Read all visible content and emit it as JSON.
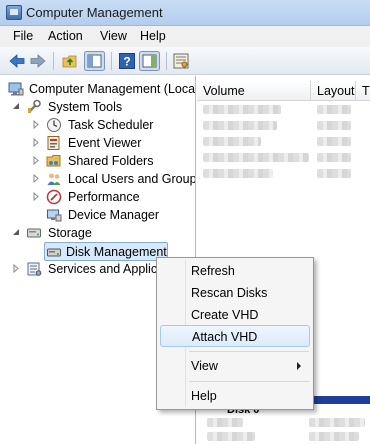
{
  "window": {
    "title": "Computer Management"
  },
  "menu": [
    "File",
    "Action",
    "View",
    "Help"
  ],
  "toolbar": {
    "buttons": [
      "back-arrow-icon",
      "forward-arrow-icon",
      "up-folder-icon",
      "show-hide-tree-icon",
      "help-icon",
      "show-action-pane-icon",
      "properties-icon"
    ]
  },
  "tree": {
    "root": "Computer Management (Local",
    "system_tools": "System Tools",
    "task_scheduler": "Task Scheduler",
    "event_viewer": "Event Viewer",
    "shared_folders": "Shared Folders",
    "local_users": "Local Users and Groups",
    "performance": "Performance",
    "device_manager": "Device Manager",
    "storage": "Storage",
    "disk_management": "Disk Management",
    "services": "Services and Applica"
  },
  "list": {
    "columns": [
      "Volume",
      "Layout",
      "T"
    ]
  },
  "disk": {
    "label": "Disk 0"
  },
  "context_menu": {
    "items": [
      "Refresh",
      "Rescan Disks",
      "Create VHD",
      "Attach VHD",
      "View",
      "Help"
    ],
    "hovered": "Attach VHD"
  },
  "colors": {
    "selection": "#d6e8fa",
    "disk_bar": "#1f3f9a",
    "title_bar": "#c9def5"
  }
}
